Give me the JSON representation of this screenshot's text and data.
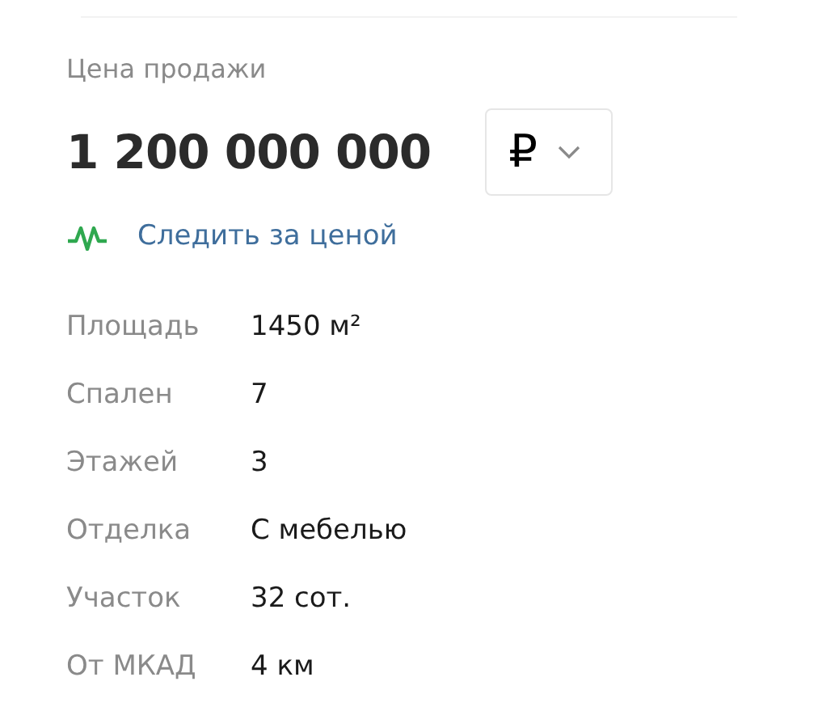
{
  "price_label": "Цена продажи",
  "price": "1 200 000 000",
  "currency": {
    "symbol": "₽"
  },
  "track_link": "Следить за ценой",
  "specs": [
    {
      "label": "Площадь",
      "value": "1450 м²"
    },
    {
      "label": "Спален",
      "value": "7"
    },
    {
      "label": "Этажей",
      "value": "3"
    },
    {
      "label": "Отделка",
      "value": "С мебелью"
    },
    {
      "label": "Участок",
      "value": "32 сот."
    },
    {
      "label": "От МКАД",
      "value": "4 км"
    }
  ]
}
